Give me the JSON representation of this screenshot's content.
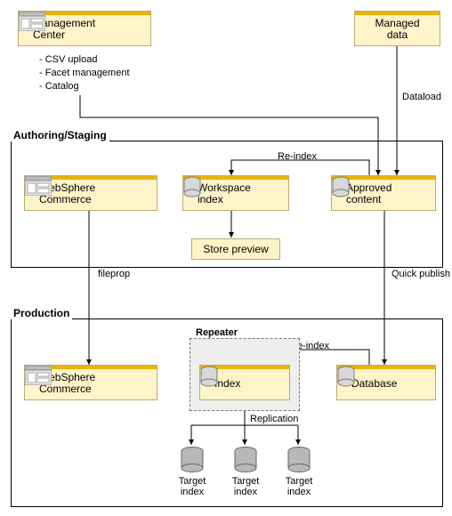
{
  "top": {
    "mgmt_center": "Management\nCenter",
    "managed_data": "Managed\ndata",
    "bullets": [
      "CSV upload",
      "Facet management",
      "Catalog"
    ],
    "dataload_label": "Dataload"
  },
  "authoring": {
    "title": "Authoring/Staging",
    "websphere": "WebSphere\nCommerce",
    "workspace_index": "Workspace\nindex",
    "approved_content": "Approved\ncontent",
    "store_preview": "Store preview",
    "reindex_label": "Re-index",
    "fileprop_label": "fileprop",
    "quick_publish_label": "Quick publish"
  },
  "production": {
    "title": "Production",
    "websphere": "WebSphere\nCommerce",
    "repeater_title": "Repeater",
    "index": "Index",
    "database": "Database",
    "reindex_label": "Re-index",
    "replication_label": "Replication",
    "target_index": "Target\nindex"
  }
}
